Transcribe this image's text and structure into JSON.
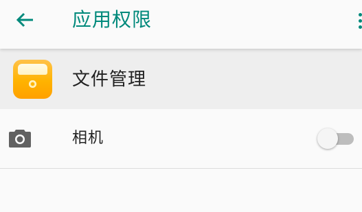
{
  "appbar": {
    "back_icon": "arrow-back-icon",
    "title": "应用权限",
    "overflow_icon": "more-vert-icon",
    "accent_color": "#00897b"
  },
  "app": {
    "name": "文件管理",
    "icon": "file-manager-app-icon",
    "icon_color": "#ffb300"
  },
  "permissions": [
    {
      "icon": "camera-icon",
      "label": "相机",
      "enabled": false
    }
  ]
}
